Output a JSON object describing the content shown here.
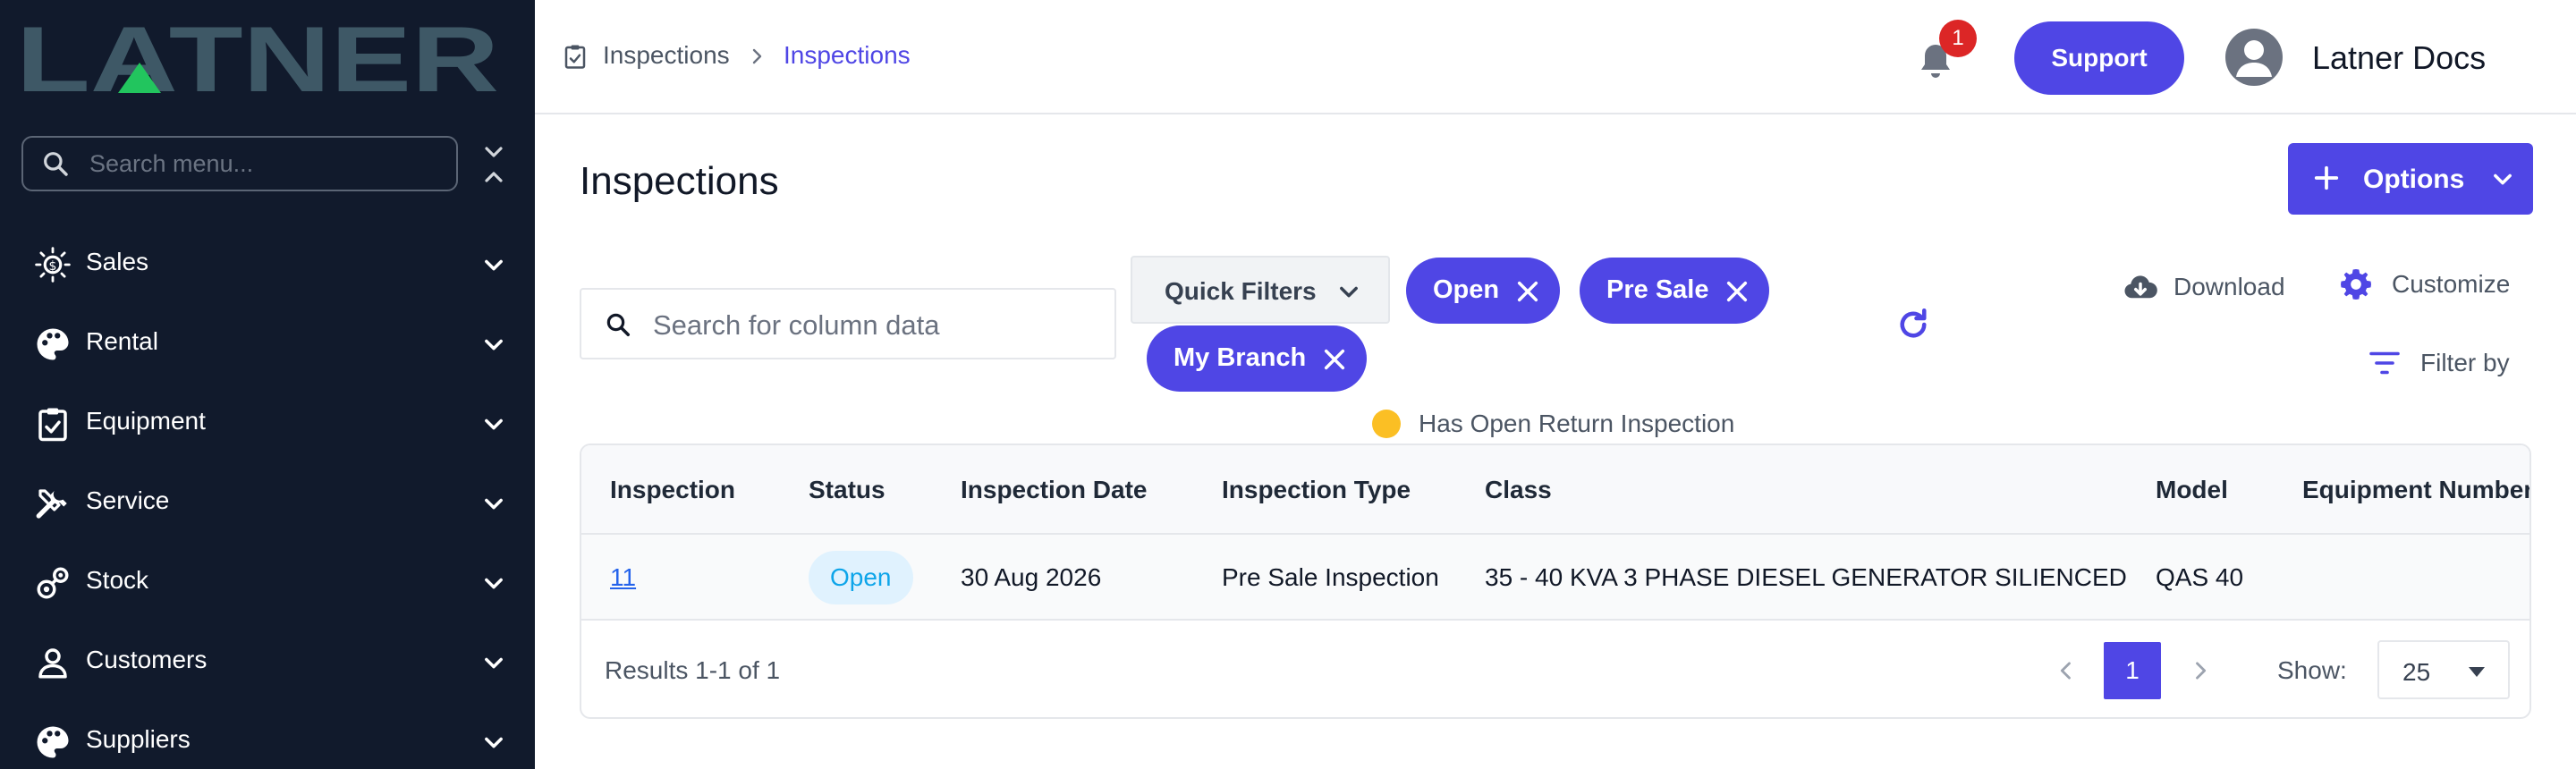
{
  "colors": {
    "accent": "#4f46e5",
    "sidebar_bg": "#111a2c",
    "badge": "#dc2626",
    "legend_dot": "#fbbf24",
    "status_open_bg": "#e0f2fe",
    "status_open_fg": "#0ea5e9"
  },
  "sidebar": {
    "logo_text": "LATNER",
    "search_placeholder": "Search menu...",
    "items": [
      {
        "label": "Sales",
        "icon": "sales-icon"
      },
      {
        "label": "Rental",
        "icon": "rental-icon"
      },
      {
        "label": "Equipment",
        "icon": "clipboard-check-icon"
      },
      {
        "label": "Service",
        "icon": "tools-icon"
      },
      {
        "label": "Stock",
        "icon": "stock-icon"
      },
      {
        "label": "Customers",
        "icon": "person-icon"
      },
      {
        "label": "Suppliers",
        "icon": "palette-icon"
      }
    ]
  },
  "header": {
    "breadcrumb": [
      "Inspections",
      "Inspections"
    ],
    "notification_count": "1",
    "support_label": "Support",
    "user_name": "Latner Docs"
  },
  "main": {
    "title": "Inspections",
    "options_label": "Options",
    "search_placeholder": "Search for column data",
    "quick_filters_label": "Quick Filters",
    "chips": [
      "Open",
      "Pre Sale",
      "My Branch"
    ],
    "download_label": "Download",
    "customize_label": "Customize",
    "filter_by_label": "Filter by",
    "legend_label": "Has Open Return Inspection"
  },
  "table": {
    "columns": [
      "Inspection",
      "Status",
      "Inspection Date",
      "Inspection Type",
      "Class",
      "Model",
      "Equipment Number"
    ],
    "rows": [
      {
        "inspection": "11",
        "status": "Open",
        "date": "30 Aug 2026",
        "type": "Pre Sale Inspection",
        "class": "35 - 40 KVA 3 PHASE DIESEL GENERATOR SILIENCED",
        "model": "QAS 40",
        "equipment_number": ""
      }
    ],
    "results_text": "Results 1-1 of 1",
    "current_page": "1",
    "show_label": "Show:",
    "page_size": "25"
  }
}
